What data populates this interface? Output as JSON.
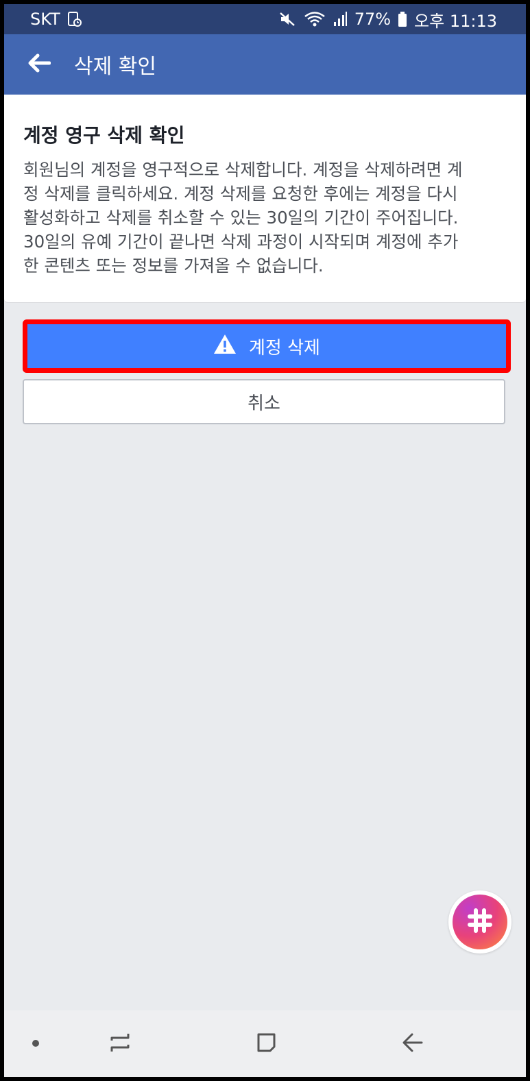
{
  "status_bar": {
    "carrier": "SKT",
    "battery": "77%",
    "time": "오후 11:13"
  },
  "app_bar": {
    "title": "삭제 확인"
  },
  "card": {
    "title": "계정 영구 삭제 확인",
    "body_lines": [
      "회원님의 계정을 영구적으로 삭제합니다. 계정을 삭제하려면 계",
      "정 삭제를 클릭하세요. 계정 삭제를 요청한 후에는 계정을 다시",
      "활성화하고 삭제를 취소할 수 있는 30일의 기간이 주어집니다.",
      "30일의 유예 기간이 끝나면 삭제 과정이 시작되며 계정에 추가",
      "한 콘텐츠 또는 정보를 가져올 수 없습니다."
    ]
  },
  "buttons": {
    "delete_label": "계정 삭제",
    "cancel_label": "취소"
  },
  "colors": {
    "status_bar": "#2b4173",
    "app_bar": "#4267b2",
    "primary_button": "#4080ff",
    "highlight": "#ff0000"
  },
  "icons": {
    "back": "arrow-left-icon",
    "warning": "warning-triangle-icon",
    "fab": "hashtag-icon"
  }
}
